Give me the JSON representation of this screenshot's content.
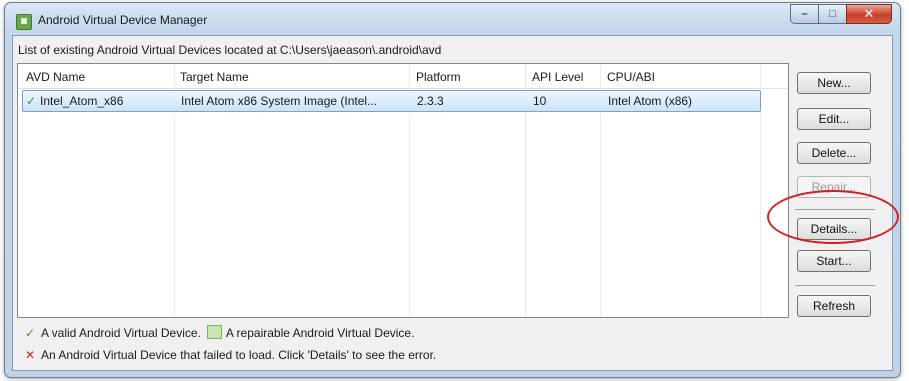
{
  "window": {
    "title": "Android Virtual Device Manager"
  },
  "header": {
    "path_label": "List of existing Android Virtual Devices located at C:\\Users\\jaeason\\.android\\avd"
  },
  "table": {
    "columns": [
      "AVD Name",
      "Target Name",
      "Platform",
      "API Level",
      "CPU/ABI"
    ],
    "rows": [
      {
        "status_icon": "check-icon",
        "name": "Intel_Atom_x86",
        "target": "Intel Atom x86 System Image (Intel...",
        "platform": "2.3.3",
        "api_level": "10",
        "cpu_abi": "Intel Atom (x86)"
      }
    ]
  },
  "buttons": {
    "new": "New...",
    "edit": "Edit...",
    "delete": "Delete...",
    "repair": "Repair...",
    "details": "Details...",
    "start": "Start...",
    "refresh": "Refresh"
  },
  "legend": {
    "valid_text": "A valid Android Virtual Device.",
    "repairable_text": "A repairable Android Virtual Device.",
    "failed_text": "An Android Virtual Device that failed to load. Click 'Details' to see the error."
  },
  "colors": {
    "highlight_circle": "#d42020",
    "valid_check": "#2e9a2e",
    "selected_row": "#c9e4fa"
  }
}
